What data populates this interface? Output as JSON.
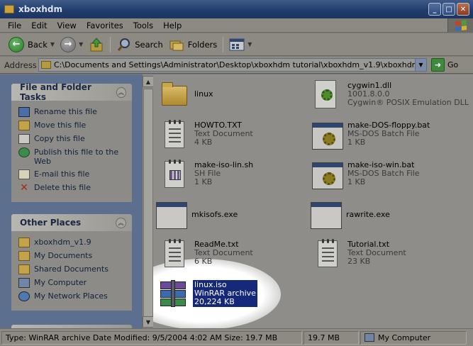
{
  "window": {
    "title": "xboxhdm"
  },
  "menu": {
    "items": [
      "File",
      "Edit",
      "View",
      "Favorites",
      "Tools",
      "Help"
    ]
  },
  "toolbar": {
    "back": "Back",
    "search": "Search",
    "folders": "Folders"
  },
  "address": {
    "label": "Address",
    "value": "C:\\Documents and Settings\\Administrator\\Desktop\\xboxhdm tutorial\\xboxhdm_v1.9\\xboxhdm",
    "go": "Go"
  },
  "tasks": {
    "title": "File and Folder Tasks",
    "items": [
      "Rename this file",
      "Move this file",
      "Copy this file",
      "Publish this file to the Web",
      "E-mail this file",
      "Delete this file"
    ]
  },
  "places": {
    "title": "Other Places",
    "items": [
      "xboxhdm_v1.9",
      "My Documents",
      "Shared Documents",
      "My Computer",
      "My Network Places"
    ]
  },
  "files": [
    {
      "name": "linux",
      "type": "",
      "size": "",
      "icon": "folder-icon"
    },
    {
      "name": "cygwin1.dll",
      "type": "1001.8.0.0",
      "size": "Cygwin® POSIX Emulation DLL",
      "icon": "dll-icon"
    },
    {
      "name": "HOWTO.TXT",
      "type": "Text Document",
      "size": "4 KB",
      "icon": "text-document-icon"
    },
    {
      "name": "make-DOS-floppy.bat",
      "type": "MS-DOS Batch File",
      "size": "1 KB",
      "icon": "batch-file-icon"
    },
    {
      "name": "make-iso-lin.sh",
      "type": "SH File",
      "size": "1 KB",
      "icon": "sh-file-icon"
    },
    {
      "name": "make-iso-win.bat",
      "type": "MS-DOS Batch File",
      "size": "1 KB",
      "icon": "batch-file-icon"
    },
    {
      "name": "mkisofs.exe",
      "type": "",
      "size": "",
      "icon": "exe-icon"
    },
    {
      "name": "rawrite.exe",
      "type": "",
      "size": "",
      "icon": "exe-icon"
    },
    {
      "name": "ReadMe.txt",
      "type": "Text Document",
      "size": "6 KB",
      "icon": "text-document-icon"
    },
    {
      "name": "Tutorial.txt",
      "type": "Text Document",
      "size": "23 KB",
      "icon": "text-document-icon"
    },
    {
      "name": "linux.iso",
      "type": "WinRAR archive",
      "size": "20,224 KB",
      "icon": "winrar-archive-icon",
      "selected": true
    }
  ],
  "status": {
    "info": "Type: WinRAR archive Date Modified: 9/5/2004 4:02 AM Size: 19.7 MB",
    "size": "19.7 MB",
    "location": "My Computer"
  }
}
